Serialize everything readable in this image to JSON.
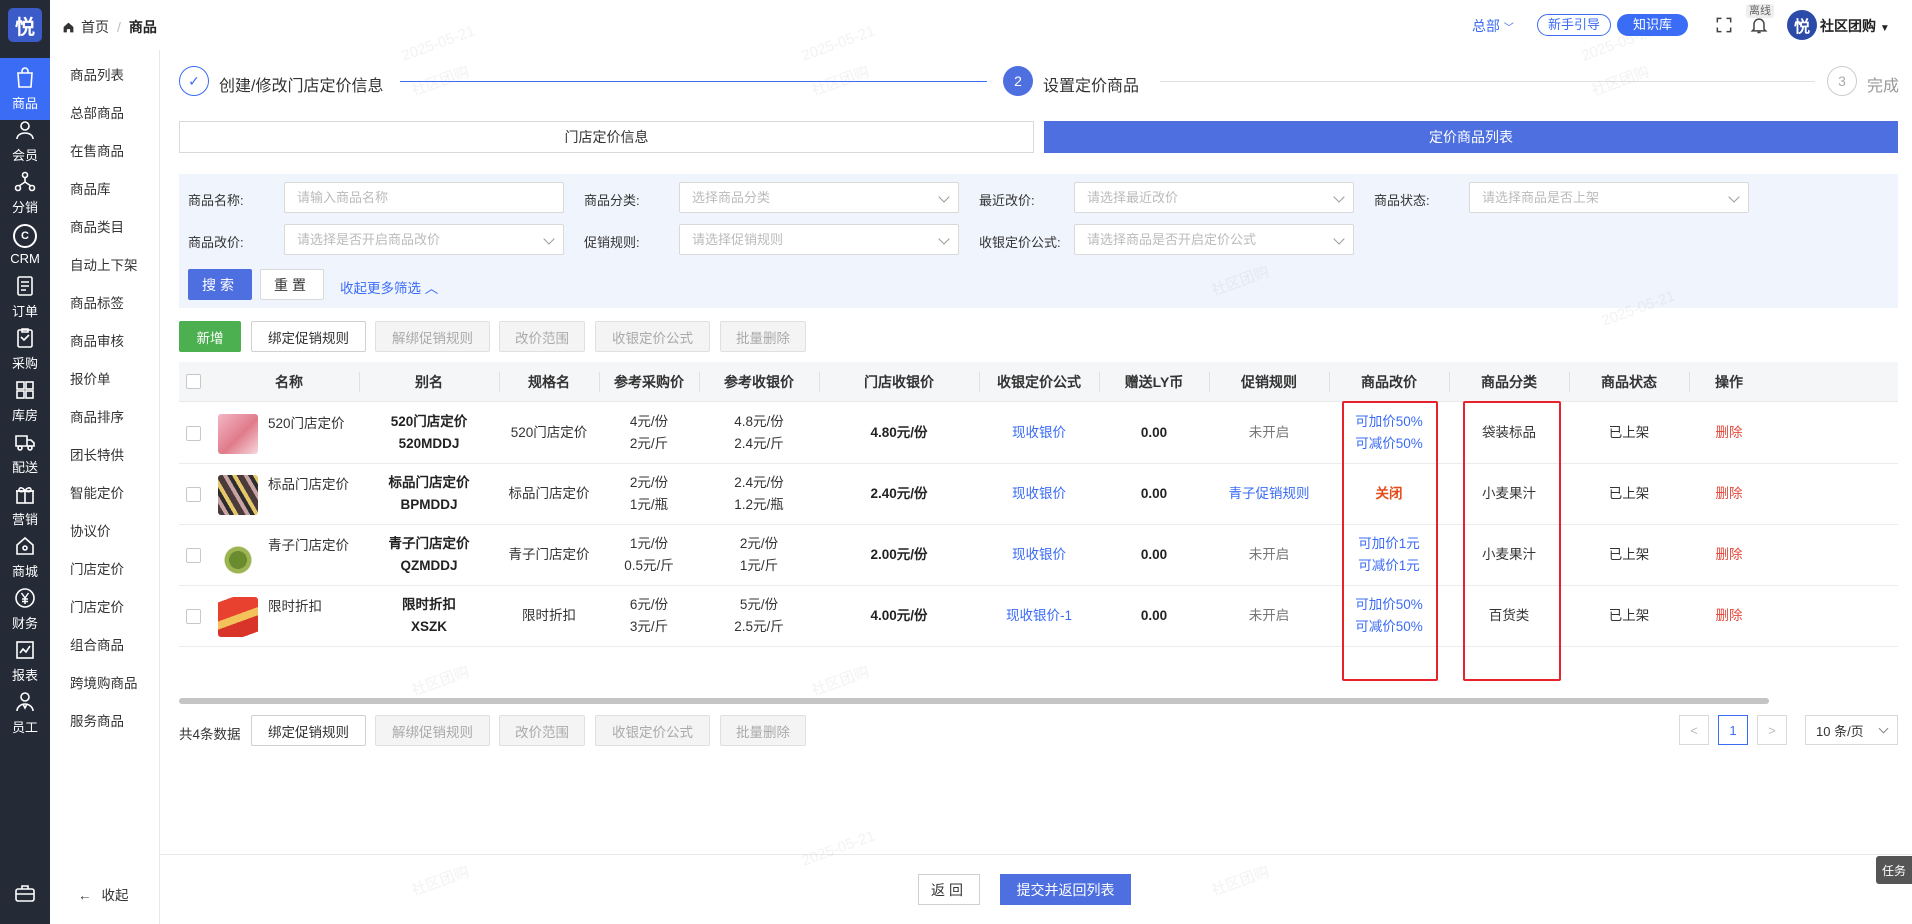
{
  "brand": {
    "logo_char": "悦",
    "accent": "#4e6fe0",
    "rail_bg": "#242a36"
  },
  "rail": [
    {
      "label": "商品",
      "icon": "bag-icon",
      "active": true
    },
    {
      "label": "会员",
      "icon": "user-icon"
    },
    {
      "label": "分销",
      "icon": "share-tree-icon"
    },
    {
      "label": "CRM",
      "icon": "crm-icon"
    },
    {
      "label": "订单",
      "icon": "order-icon"
    },
    {
      "label": "采购",
      "icon": "purchase-icon"
    },
    {
      "label": "库房",
      "icon": "grid-icon"
    },
    {
      "label": "配送",
      "icon": "truck-icon"
    },
    {
      "label": "营销",
      "icon": "gift-icon"
    },
    {
      "label": "商城",
      "icon": "home-icon"
    },
    {
      "label": "财务",
      "icon": "yen-icon"
    },
    {
      "label": "报表",
      "icon": "chart-icon"
    },
    {
      "label": "员工",
      "icon": "staff-icon"
    }
  ],
  "submenu": [
    "商品列表",
    "总部商品",
    "在售商品",
    "商品库",
    "商品类目",
    "自动上下架",
    "商品标签",
    "商品审核",
    "报价单",
    "商品排序",
    "团长特供",
    "智能定价",
    "协议价",
    "门店定价",
    "门店定价",
    "组合商品",
    "跨境购商品",
    "服务商品"
  ],
  "submenu_collapse": "收起",
  "topbar": {
    "home": "首页",
    "current": "商品",
    "hq": "总部",
    "guide": "新手引导",
    "kb": "知识库",
    "offline": "离线",
    "user": "社区团购"
  },
  "steps": [
    {
      "num": "✓",
      "label": "创建/修改门店定价信息",
      "state": "done"
    },
    {
      "num": "2",
      "label": "设置定价商品",
      "state": "active"
    },
    {
      "num": "3",
      "label": "完成",
      "state": "todo"
    }
  ],
  "tabs": {
    "info": "门店定价信息",
    "list": "定价商品列表"
  },
  "filter": {
    "name_label": "商品名称:",
    "name_placeholder": "请输入商品名称",
    "cat_label": "商品分类:",
    "cat_placeholder": "选择商品分类",
    "recent_label": "最近改价:",
    "recent_placeholder": "请选择最近改价",
    "status_label": "商品状态:",
    "status_placeholder": "请选择商品是否上架",
    "change_label": "商品改价:",
    "change_placeholder": "请选择是否开启商品改价",
    "promo_label": "促销规则:",
    "promo_placeholder": "请选择促销规则",
    "formula_label": "收银定价公式:",
    "formula_placeholder": "请选择商品是否开启定价公式",
    "search": "搜索",
    "reset": "重置",
    "more": "收起更多筛选"
  },
  "actions": {
    "add": "新增",
    "bind": "绑定促销规则",
    "unbind": "解绑促销规则",
    "range": "改价范围",
    "formula": "收银定价公式",
    "batch_delete": "批量删除"
  },
  "columns": [
    "名称",
    "别名",
    "规格名",
    "参考采购价",
    "参考收银价",
    "门店收银价",
    "收银定价公式",
    "赠送LY币",
    "促销规则",
    "商品改价",
    "商品分类",
    "商品状态",
    "操作"
  ],
  "rows": [
    {
      "name": "520门店定价",
      "alias1": "520门店定价",
      "alias2": "520MDDJ",
      "spec": "520门店定价",
      "buy1": "4元/份",
      "buy2": "2元/斤",
      "ref1": "4.8元/份",
      "ref2": "2.4元/斤",
      "store_price": "4.80元/份",
      "formula": "现收银价",
      "coin": "0.00",
      "promo": "未开启",
      "change1": "可加价50%",
      "change2": "可减价50%",
      "category": "袋装标品",
      "status": "已上架",
      "op": "删除",
      "thumb": "pink"
    },
    {
      "name": "标品门店定价",
      "alias1": "标品门店定价",
      "alias2": "BPMDDJ",
      "spec": "标品门店定价",
      "buy1": "2元/份",
      "buy2": "1元/瓶",
      "ref1": "2.4元/份",
      "ref2": "1.2元/瓶",
      "store_price": "2.40元/份",
      "formula": "现收银价",
      "coin": "0.00",
      "promo": "青子促销规则",
      "change1": "关闭",
      "change2": "",
      "category": "小麦果汁",
      "status": "已上架",
      "op": "删除",
      "thumb": "dark"
    },
    {
      "name": "青子门店定价",
      "alias1": "青子门店定价",
      "alias2": "QZMDDJ",
      "spec": "青子门店定价",
      "buy1": "1元/份",
      "buy2": "0.5元/斤",
      "ref1": "2元/份",
      "ref2": "1元/斤",
      "store_price": "2.00元/份",
      "formula": "现收银价",
      "coin": "0.00",
      "promo": "未开启",
      "change1": "可加价1元",
      "change2": "可减价1元",
      "category": "小麦果汁",
      "status": "已上架",
      "op": "删除",
      "thumb": "green"
    },
    {
      "name": "限时折扣",
      "alias1": "限时折扣",
      "alias2": "XSZK",
      "spec": "限时折扣",
      "buy1": "6元/份",
      "buy2": "3元/斤",
      "ref1": "5元/份",
      "ref2": "2.5元/斤",
      "store_price": "4.00元/份",
      "formula": "现收银价-1",
      "coin": "0.00",
      "promo": "未开启",
      "change1": "可加价50%",
      "change2": "可减价50%",
      "category": "百货类",
      "status": "已上架",
      "op": "删除",
      "thumb": "red"
    }
  ],
  "footer": {
    "total": "共4条数据",
    "prev": "<",
    "page": "1",
    "next": ">",
    "page_size": "10 条/页"
  },
  "bottom": {
    "back": "返回",
    "submit": "提交并返回列表"
  },
  "task": "任务",
  "watermark": [
    "2025-05-21",
    "社区团购"
  ]
}
